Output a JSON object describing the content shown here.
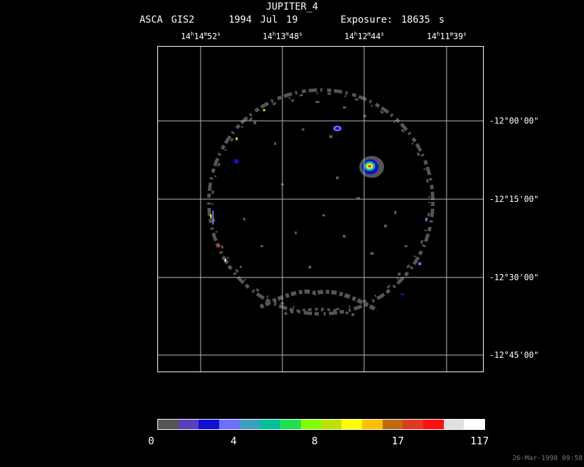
{
  "header": {
    "title": "JUPITER_4",
    "instrument": "ASCA GIS2",
    "date": "1994 Jul 19",
    "exposure": "Exposure: 18635 s"
  },
  "ra_labels": [
    {
      "h": "14",
      "m": "14",
      "s": "52"
    },
    {
      "h": "14",
      "m": "13",
      "s": "48"
    },
    {
      "h": "14",
      "m": "12",
      "s": "44"
    },
    {
      "h": "14",
      "m": "11",
      "s": "39"
    }
  ],
  "dec_labels": [
    {
      "text": "-12°00'00\""
    },
    {
      "text": "-12°15'00\""
    },
    {
      "text": "-12°30'00\""
    },
    {
      "text": "-12°45'00\""
    }
  ],
  "colorbar": {
    "colors": [
      "#555555",
      "#5a3fbf",
      "#1010d0",
      "#7070ff",
      "#3aa0c0",
      "#00c09a",
      "#20e050",
      "#80ff00",
      "#c0e000",
      "#ffff00",
      "#ffc000",
      "#c06a10",
      "#e03a20",
      "#ff1010",
      "#e0e0e0",
      "#ffffff"
    ],
    "tick_labels": [
      "0",
      "4",
      "8",
      "17",
      "117"
    ]
  },
  "timestamp": "26-Mar-1998 09:58"
}
